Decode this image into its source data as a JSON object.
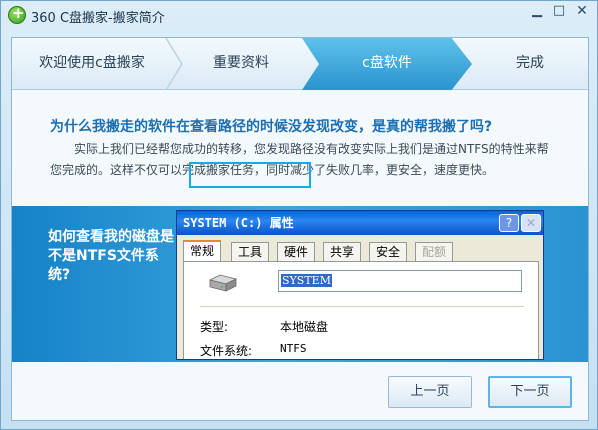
{
  "window": {
    "title": "360 C盘搬家-搬家简介"
  },
  "steps": [
    "欢迎使用c盘搬家",
    "重要资料",
    "c盘软件",
    "完成"
  ],
  "content": {
    "question": "为什么我搬走的软件在查看路径的时候没发现改变，是真的帮我搬了吗?",
    "paragraph": "实际上我们已经帮您成功的转移，您发现路径没有改变实际上我们是通过NTFS的特性来帮您完成的。这样不仅可以完成搬家任务，同时减少了失败几率，更安全，速度更快。"
  },
  "panel": {
    "side_question": "如何查看我的磁盘是不是NTFS文件系统?"
  },
  "dialog": {
    "title": "SYSTEM (C:) 属性",
    "help_label": "?",
    "close_label": "✕",
    "tabs": [
      "常规",
      "工具",
      "硬件",
      "共享",
      "安全",
      "配额"
    ],
    "drive_name": "SYSTEM",
    "type_label": "类型:",
    "type_value": "本地磁盘",
    "fs_label": "文件系统:",
    "fs_value": "NTFS"
  },
  "buttons": {
    "prev": "上一页",
    "next": "下一页"
  },
  "colors": {
    "accent": "#2b93cf",
    "highlight": "#19a9e6",
    "question": "#1d6fb2"
  }
}
